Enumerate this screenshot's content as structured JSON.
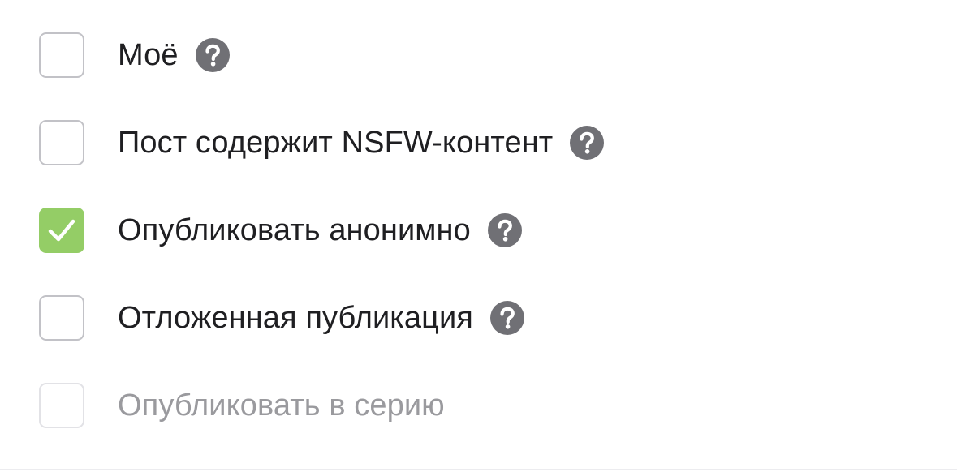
{
  "colors": {
    "checked_fill": "#94cd66",
    "checkbox_border": "#c2c2c7",
    "help_icon": "#707075",
    "label_text": "#1f1f22",
    "disabled_text": "#9a9a9e"
  },
  "options": [
    {
      "label": "Моё",
      "checked": false,
      "disabled": false,
      "help_icon": "question-circle-icon"
    },
    {
      "label": "Пост содержит NSFW-контент",
      "checked": false,
      "disabled": false,
      "help_icon": "question-circle-icon"
    },
    {
      "label": "Опубликовать анонимно",
      "checked": true,
      "disabled": false,
      "help_icon": "question-circle-icon"
    },
    {
      "label": "Отложенная публикация",
      "checked": false,
      "disabled": false,
      "help_icon": "question-circle-icon"
    },
    {
      "label": "Опубликовать в серию",
      "checked": false,
      "disabled": true,
      "help_icon": null
    }
  ]
}
